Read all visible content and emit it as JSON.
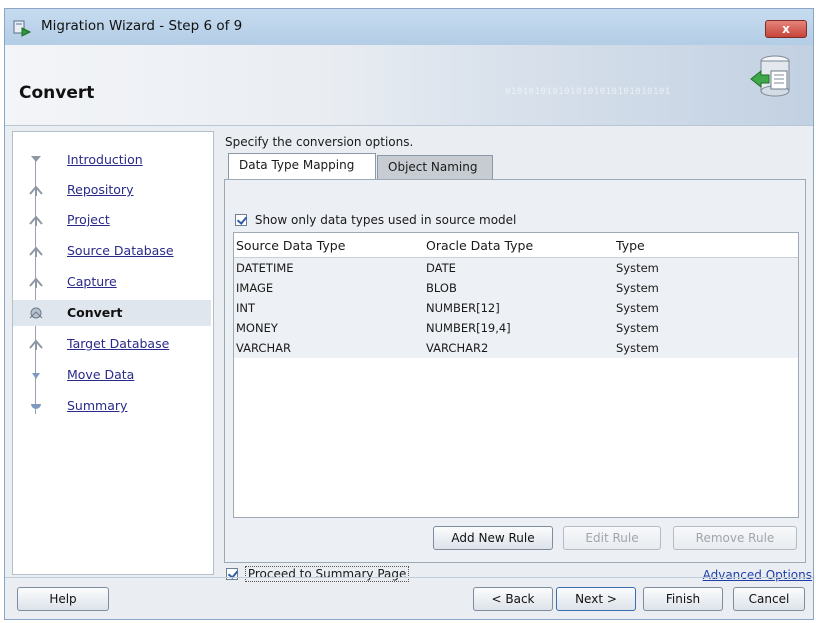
{
  "window": {
    "title": "Migration Wizard - Step 6 of 9",
    "close_label": "x"
  },
  "banner": {
    "heading": "Convert",
    "binary_text": "0101010101010101010101010101"
  },
  "steps": [
    {
      "label": "Introduction"
    },
    {
      "label": "Repository"
    },
    {
      "label": "Project"
    },
    {
      "label": "Source Database"
    },
    {
      "label": "Capture"
    },
    {
      "label": "Convert"
    },
    {
      "label": "Target Database"
    },
    {
      "label": "Move Data"
    },
    {
      "label": "Summary"
    }
  ],
  "main": {
    "instructions": "Specify the conversion options.",
    "tabs": [
      "Data Type Mapping",
      "Object Naming"
    ],
    "show_only_label": "Show only data types used in source model",
    "table": {
      "headers": [
        "Source Data Type",
        "Oracle Data Type",
        "Type"
      ],
      "rows": [
        [
          "DATETIME",
          "DATE",
          "System"
        ],
        [
          "IMAGE",
          "BLOB",
          "System"
        ],
        [
          "INT",
          "NUMBER[12]",
          "System"
        ],
        [
          "MONEY",
          "NUMBER[19,4]",
          "System"
        ],
        [
          "VARCHAR",
          "VARCHAR2",
          "System"
        ]
      ]
    },
    "rule_buttons": {
      "add": "Add New Rule",
      "edit": "Edit Rule",
      "remove": "Remove Rule"
    },
    "proceed_label": "Proceed to Summary Page",
    "advanced_options": "Advanced Options"
  },
  "footer": {
    "help": "Help",
    "back": "< Back",
    "next": "Next >",
    "finish": "Finish",
    "cancel": "Cancel"
  }
}
